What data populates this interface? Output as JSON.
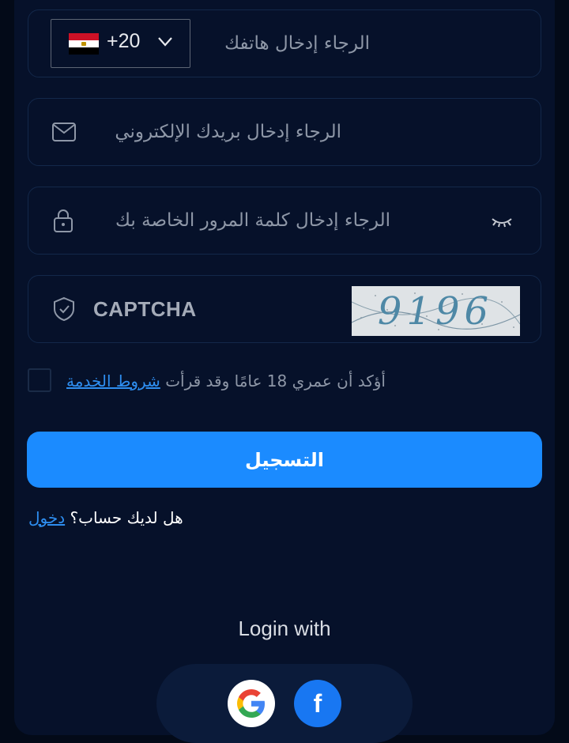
{
  "form": {
    "phone": {
      "country_code": "+20",
      "placeholder": "الرجاء إدخال هاتفك",
      "flag_icon": "egypt-flag-icon",
      "flag_colors": [
        "#ce1126",
        "#ffffff",
        "#000000"
      ]
    },
    "email": {
      "placeholder": "الرجاء إدخال بريدك الإلكتروني",
      "icon": "mail-icon"
    },
    "password": {
      "placeholder": "الرجاء إدخال كلمة المرور الخاصة بك",
      "icon": "lock-icon",
      "toggle_icon": "eye-closed-icon"
    },
    "captcha": {
      "label": "CAPTCHA",
      "icon": "shield-check-icon",
      "code": "9196"
    },
    "terms": {
      "text": "أؤكد أن عمري 18 عامًا وقد قرأت",
      "link": "شروط الخدمة",
      "checked": false
    },
    "register_button": "التسجيل",
    "have_account": {
      "text": "هل لديك حساب؟",
      "link": "دخول"
    }
  },
  "social": {
    "title": "Login with",
    "providers": [
      {
        "name": "google-icon"
      },
      {
        "name": "facebook-icon",
        "glyph": "f"
      }
    ]
  },
  "colors": {
    "background": "#030a18",
    "panel": "#06112a",
    "accent": "#1b8bff",
    "link": "#2e8ef0",
    "field_border": "#13284a"
  }
}
